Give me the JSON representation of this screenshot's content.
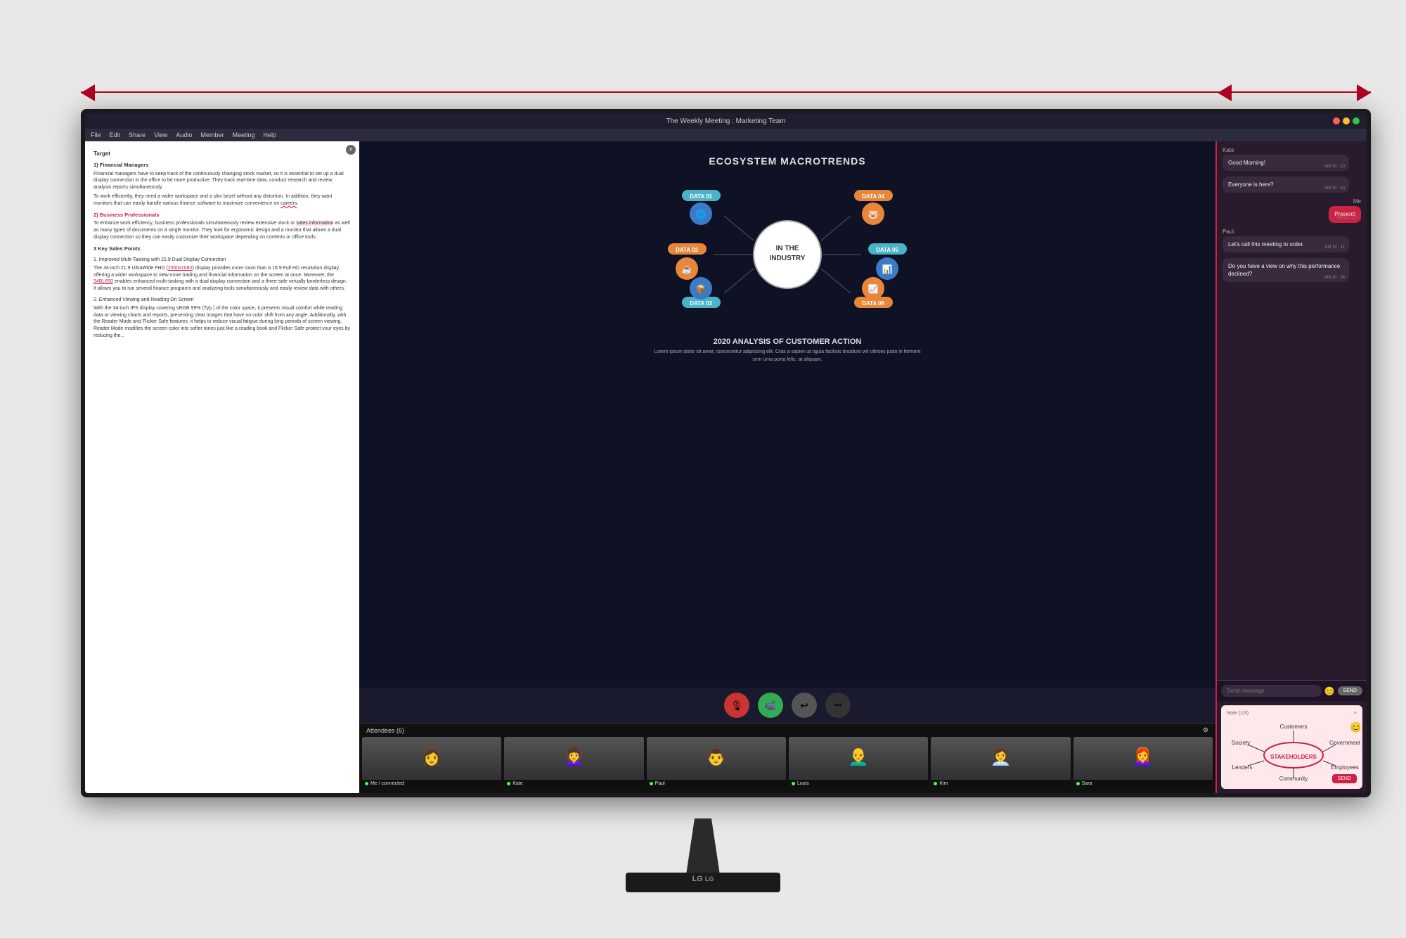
{
  "monitor": {
    "title": "The Weekly Meeting : Marketing Team",
    "brand": "LG",
    "controls": [
      "red",
      "yellow",
      "green"
    ]
  },
  "menubar": {
    "items": [
      "File",
      "Edit",
      "Share",
      "View",
      "Audio",
      "Member",
      "Meeting",
      "Help"
    ]
  },
  "document": {
    "title": "Target",
    "section1_title": "1) Financial Managers",
    "section1_text": "Financial managers have to keep track of the continuously changing stock market, so it is essential to set up a dual display connection in the office to be more productive. They track real-time data, conduct research and review analysis reports simultaneously.",
    "section1_text2": "To work efficiently, they need a wider workspace and a slim bezel without any distortion. In addition, they want monitors that can easily handle various finance software to maximize convenience on careers.",
    "section2_title": "2) Business Professionals",
    "section2_text": "To enhance work efficiency, business professionals simultaneously review extensive stock or sales information as well as many types of documents on a single monitor. They look for ergonomic design and a monitor that allows a dual display connection so they can easily customize their workspace depending on contents or office tools.",
    "section3_title": "3 Key Sales Points",
    "ksp1_title": "1. Improved Multi-Tasking with 21:9 Dual Display Connection",
    "ksp1_text": "The 34-inch 21:9 UltraWide FHD (2560x1080) display provides more room than a 16:9 Full HD resolution display, offering a wider workspace to view more trading and financial information on the screen at once. Moreover, the 34BL650 enables enhanced multi-tasking with a dual display connection and a three-side virtually borderless design. It allows you to run several finance programs and analyzing tools simultaneously and easily review data with others.",
    "ksp2_title": "2. Enhanced Viewing and Reading On Screen",
    "ksp2_text": "With the 34-inch IPS display covering sRGB 99% (Typ.) of the color space, it presents visual comfort while reading data or viewing charts and reports, presenting clear images that have no color shift from any angle."
  },
  "slide": {
    "title": "ECOSYSTEM MACROTRENDS",
    "center_text": "IN THE\nINDUSTRY",
    "data_points": [
      {
        "label": "DATA 01",
        "position": "top-left",
        "icon": "🌐"
      },
      {
        "label": "DATA 02",
        "position": "left",
        "icon": "☕"
      },
      {
        "label": "DATA 03",
        "position": "bottom-left",
        "icon": "📦"
      },
      {
        "label": "DATA 04",
        "position": "top-right",
        "icon": "🐷"
      },
      {
        "label": "DATA 05",
        "position": "right",
        "icon": "📊"
      },
      {
        "label": "DATA 06",
        "position": "bottom-right",
        "icon": "📈"
      }
    ],
    "analysis_title": "2020 ANALYSIS OF CUSTOMER ACTION",
    "analysis_text": "Lorem ipsum dolor sit amet, consectetur adipiscing elit. Cras a sapien at ligula facilisis tincidunt vel ultrices justo in ferment sem urna porta felis, at aliquam."
  },
  "attendees": {
    "header": "Attendees (6)",
    "list": [
      {
        "name": "Me / connected",
        "status": "connected"
      },
      {
        "name": "Kate",
        "status": "online"
      },
      {
        "name": "Paul",
        "status": "online"
      },
      {
        "name": "Louis",
        "status": "online"
      },
      {
        "name": "Kim",
        "status": "online"
      },
      {
        "name": "Sara",
        "status": "online"
      }
    ]
  },
  "chat": {
    "messages": [
      {
        "sender": "Kate",
        "text": "Good Morning!",
        "time": "AM 10 : 10",
        "mine": false
      },
      {
        "sender": "",
        "text": "Everyone is here?",
        "time": "AM 10 : 10",
        "mine": false
      },
      {
        "sender": "Me",
        "text": "Present!",
        "time": "AM 10 : 12",
        "mine": true
      },
      {
        "sender": "Paul",
        "text": "Let's call this meeting to order.",
        "time": "AM 10 : 11",
        "mine": false
      },
      {
        "sender": "",
        "text": "Do you have a view on why this performance declined?",
        "time": "AM 10 : 14",
        "mine": false
      }
    ],
    "input_placeholder": "Send message",
    "send_label": "SEND"
  },
  "note": {
    "header": "Note (1/3)",
    "close_label": "×",
    "send_label": "SEND",
    "stakeholders": {
      "center": "STAKEHOLDERS",
      "nodes": [
        "Customers",
        "Society",
        "Government",
        "Lenders",
        "Community",
        "Employees"
      ]
    }
  },
  "controls": {
    "mic_label": "mic",
    "video_label": "video",
    "share_label": "share",
    "more_label": "more"
  },
  "measurement": {
    "label": "width measurement"
  }
}
